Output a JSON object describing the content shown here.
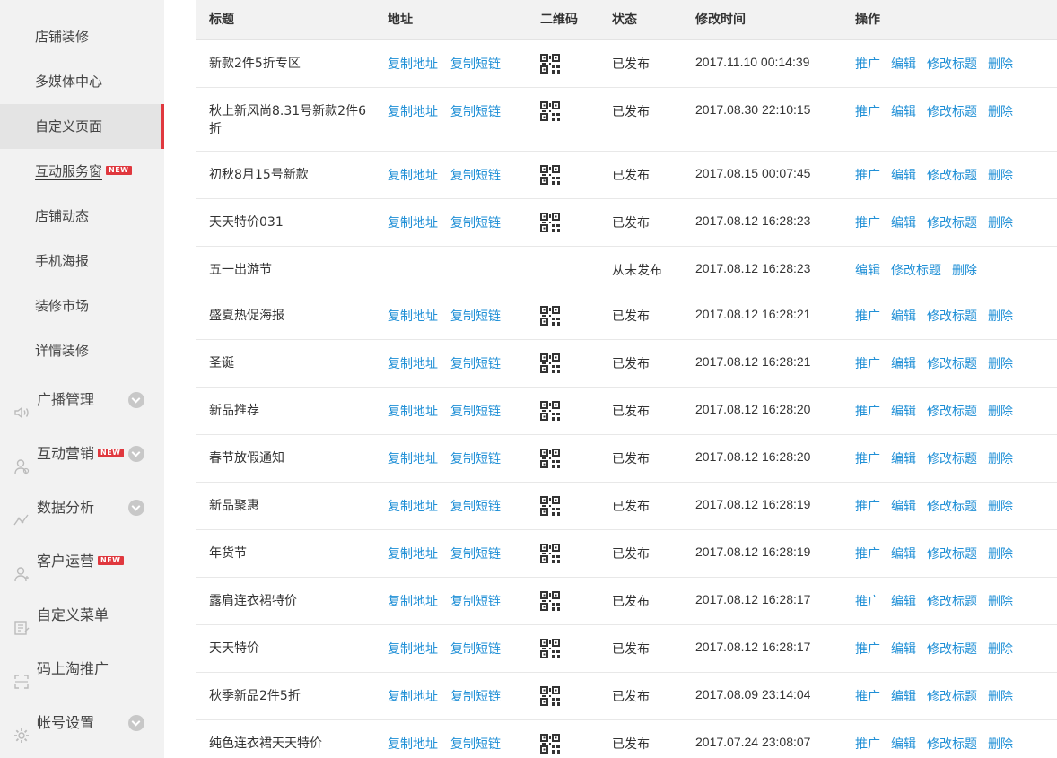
{
  "sidebar": {
    "items": [
      {
        "label": "店铺装修",
        "active": false,
        "is_new": false
      },
      {
        "label": "多媒体中心",
        "active": false,
        "is_new": false
      },
      {
        "label": "自定义页面",
        "active": true,
        "is_new": false
      },
      {
        "label": "互动服务窗",
        "active": false,
        "is_new": true,
        "new_label": "NEW"
      },
      {
        "label": "店铺动态",
        "active": false,
        "is_new": false
      },
      {
        "label": "手机海报",
        "active": false,
        "is_new": false
      },
      {
        "label": "装修市场",
        "active": false,
        "is_new": false
      },
      {
        "label": "详情装修",
        "active": false,
        "is_new": false
      }
    ],
    "groups": [
      {
        "label": "广播管理",
        "icon": "speaker-icon",
        "is_new": false,
        "expandable": true
      },
      {
        "label": "互动营销",
        "icon": "user-icon",
        "is_new": true,
        "new_label": "NEW",
        "expandable": true
      },
      {
        "label": "数据分析",
        "icon": "analytics-icon",
        "is_new": false,
        "expandable": true
      },
      {
        "label": "客户运营",
        "icon": "customer-icon",
        "is_new": true,
        "new_label": "NEW",
        "expandable": false
      },
      {
        "label": "自定义菜单",
        "icon": "menu-edit-icon",
        "is_new": false,
        "expandable": false
      },
      {
        "label": "码上淘推广",
        "icon": "scan-icon",
        "is_new": false,
        "expandable": false
      },
      {
        "label": "帐号设置",
        "icon": "gear-icon",
        "is_new": false,
        "expandable": true
      }
    ]
  },
  "table": {
    "headers": {
      "title": "标题",
      "address": "地址",
      "qrcode": "二维码",
      "status": "状态",
      "modified": "修改时间",
      "actions": "操作"
    },
    "link_labels": {
      "copy_address": "复制地址",
      "copy_short": "复制短链",
      "promote": "推广",
      "edit": "编辑",
      "rename": "修改标题",
      "delete": "删除"
    },
    "rows": [
      {
        "title": "新款2件5折专区",
        "status": "已发布",
        "time": "2017.11.10 00:14:39",
        "published": true
      },
      {
        "title": "秋上新风尚8.31号新款2件6折",
        "status": "已发布",
        "time": "2017.08.30 22:10:15",
        "published": true
      },
      {
        "title": "初秋8月15号新款",
        "status": "已发布",
        "time": "2017.08.15 00:07:45",
        "published": true
      },
      {
        "title": "天天特价031",
        "status": "已发布",
        "time": "2017.08.12 16:28:23",
        "published": true
      },
      {
        "title": "五一出游节",
        "status": "从未发布",
        "time": "2017.08.12 16:28:23",
        "published": false
      },
      {
        "title": "盛夏热促海报",
        "status": "已发布",
        "time": "2017.08.12 16:28:21",
        "published": true
      },
      {
        "title": "圣诞",
        "status": "已发布",
        "time": "2017.08.12 16:28:21",
        "published": true
      },
      {
        "title": "新品推荐",
        "status": "已发布",
        "time": "2017.08.12 16:28:20",
        "published": true
      },
      {
        "title": "春节放假通知",
        "status": "已发布",
        "time": "2017.08.12 16:28:20",
        "published": true
      },
      {
        "title": "新品聚惠",
        "status": "已发布",
        "time": "2017.08.12 16:28:19",
        "published": true
      },
      {
        "title": "年货节",
        "status": "已发布",
        "time": "2017.08.12 16:28:19",
        "published": true
      },
      {
        "title": "露肩连衣裙特价",
        "status": "已发布",
        "time": "2017.08.12 16:28:17",
        "published": true
      },
      {
        "title": "天天特价",
        "status": "已发布",
        "time": "2017.08.12 16:28:17",
        "published": true
      },
      {
        "title": "秋季新品2件5折",
        "status": "已发布",
        "time": "2017.08.09 23:14:04",
        "published": true
      },
      {
        "title": "纯色连衣裙天天特价",
        "status": "已发布",
        "time": "2017.07.24 23:08:07",
        "published": true
      }
    ]
  },
  "colors": {
    "link": "#1f8fd6",
    "accent": "#e0383e",
    "sidebar_bg": "#f2f2f2"
  }
}
